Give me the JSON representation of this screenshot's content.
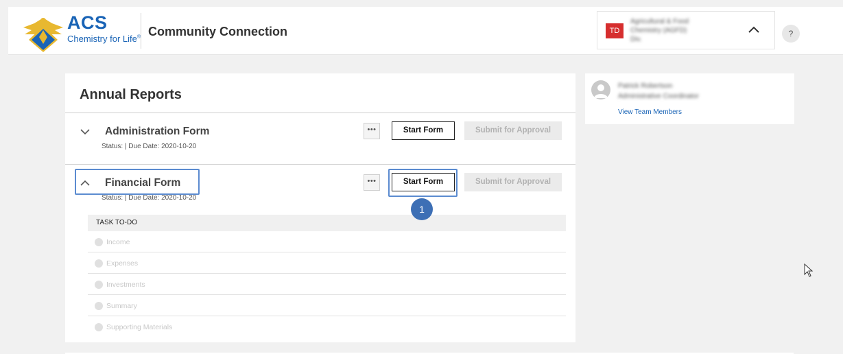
{
  "header": {
    "logo_text": "ACS",
    "logo_tagline": "Chemistry for Life",
    "logo_tagline_mark": "®",
    "app_title": "Community Connection",
    "org": {
      "initials": "TD",
      "name_line1": "Agricultural & Food",
      "name_line2": "Chemistry (AGFD)",
      "name_line3": "Div.",
      "caret_icon": "chevron-up-icon"
    },
    "help_label": "?"
  },
  "annual_reports": {
    "title": "Annual Reports",
    "forms": [
      {
        "name": "Administration Form",
        "status": "Status: | Due Date: 2020-10-20",
        "more_label": "•••",
        "start_label": "Start Form",
        "submit_label": "Submit for Approval",
        "expanded": false
      },
      {
        "name": "Financial Form",
        "status": "Status: | Due Date: 2020-10-20",
        "more_label": "•••",
        "start_label": "Start Form",
        "submit_label": "Submit for Approval",
        "expanded": true
      }
    ],
    "todo_header": "TASK TO-DO",
    "tasks": [
      "Income",
      "Expenses",
      "Investments",
      "Summary",
      "Supporting Materials"
    ],
    "step_badge": "1"
  },
  "side_panel": {
    "name_line1": "Patrick Robertson",
    "name_line2": "Administrative Coordinator",
    "link": "View Team Members"
  },
  "colors": {
    "brand_blue": "#1a64b6",
    "highlight": "#5b8bd0",
    "badge": "#3d6fb5",
    "avatar_red": "#d62e2e"
  }
}
